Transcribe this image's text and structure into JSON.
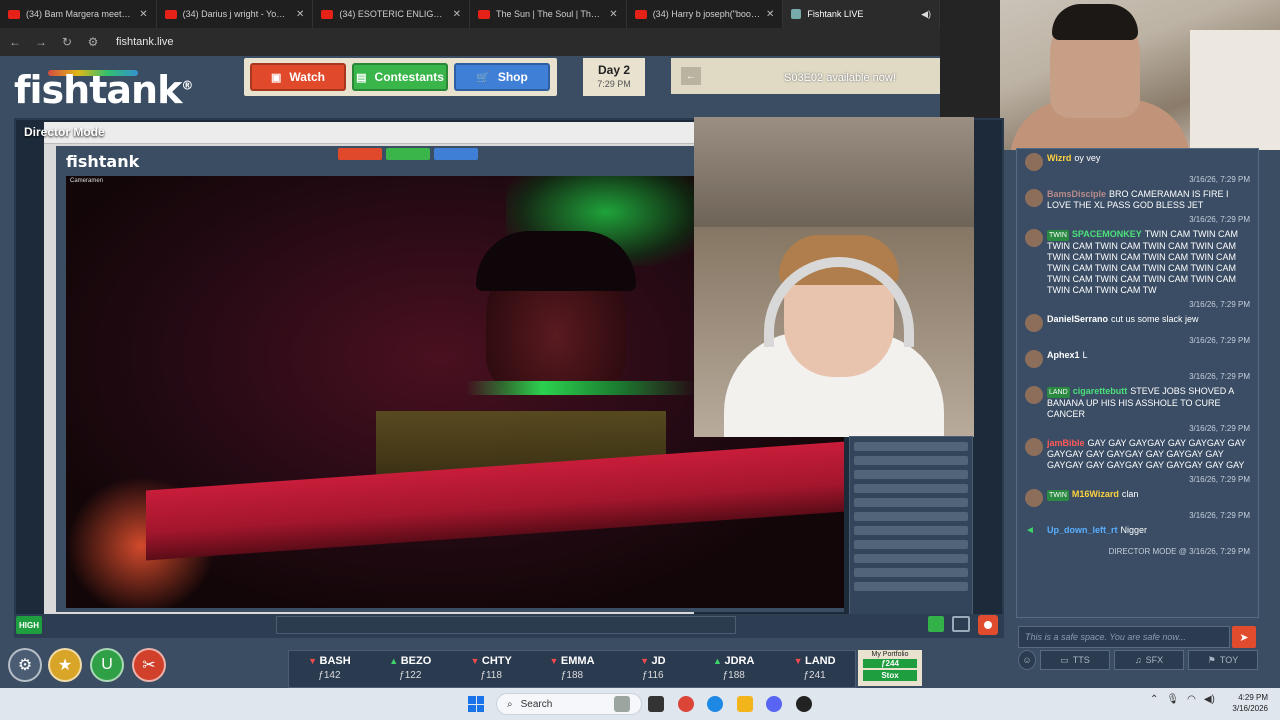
{
  "browser": {
    "tabs": [
      {
        "label": "(34) Bam Margera meets Jame",
        "icon": "youtube-icon"
      },
      {
        "label": "(34) Darius j wright - YouTube",
        "icon": "youtube-icon"
      },
      {
        "label": "(34) ESOTERIC ENLIGHTENMEN",
        "icon": "youtube-icon"
      },
      {
        "label": "The Sun | The Soul | The Four E",
        "icon": "youtube-icon"
      },
      {
        "label": "(34) Harry b joseph(\"book of w",
        "icon": "youtube-icon"
      },
      {
        "label": "Fishtank LIVE",
        "icon": "fishtank-icon"
      }
    ],
    "url": "fishtank.live"
  },
  "header": {
    "logo": "fishtank",
    "logo_mark": "®",
    "nav": {
      "watch": "Watch",
      "contestants": "Contestants",
      "shop": "Shop"
    },
    "day": "Day 2",
    "time": "7:29 PM",
    "notice": "S03E02 available now!"
  },
  "stage": {
    "mode_label": "Director Mode",
    "inner_logo": "fishtank",
    "camera_label": "Cameramen",
    "quality": "HIGH"
  },
  "ticker": [
    {
      "symbol": "BASH",
      "dir": "down",
      "price": "ƒ142"
    },
    {
      "symbol": "BEZO",
      "dir": "up",
      "price": "ƒ122"
    },
    {
      "symbol": "CHTY",
      "dir": "down",
      "price": "ƒ118"
    },
    {
      "symbol": "EMMA",
      "dir": "down",
      "price": "ƒ188"
    },
    {
      "symbol": "JD",
      "dir": "down",
      "price": "ƒ116"
    },
    {
      "symbol": "JDRA",
      "dir": "up",
      "price": "ƒ188"
    },
    {
      "symbol": "LAND",
      "dir": "down",
      "price": "ƒ241"
    }
  ],
  "portfolio": {
    "title": "My Portfolio",
    "value": "ƒ244",
    "button": "Stox"
  },
  "chat": {
    "messages": [
      {
        "user": "Wizrd",
        "text": "oy vey",
        "time": "3/16/26, 7:29 PM",
        "color": "yellow"
      },
      {
        "user": "BamsDisciple",
        "text": "BRO CAMERAMAN IS FIRE I LOVE THE XL PASS GOD BLESS JET",
        "time": "3/16/26, 7:29 PM",
        "color": "faded"
      },
      {
        "badge": "TWIN",
        "user": "SPACEMONKEY",
        "text": "TWIN CAM TWIN CAM TWIN CAM TWIN CAM TWIN CAM TWIN CAM TWIN CAM TWIN CAM TWIN CAM TWIN CAM TWIN CAM TWIN CAM TWIN CAM TWIN CAM TWIN CAM TWIN CAM TWIN CAM TWIN CAM TWIN CAM TWIN CAM TW",
        "time": "3/16/26, 7:29 PM",
        "color": "green"
      },
      {
        "user": "DanielSerrano",
        "text": "cut us some slack jew",
        "time": "3/16/26, 7:29 PM",
        "color": "yellow"
      },
      {
        "user": "Aphex1",
        "text": "L",
        "time": "3/16/26, 7:29 PM",
        "color": "yellow"
      },
      {
        "badge": "LAND",
        "user": "cigarettebutt",
        "text": "STEVE JOBS SHOVED A BANANA UP HIS HIS ASSHOLE TO CURE CANCER",
        "time": "3/16/26, 7:29 PM",
        "color": "green"
      },
      {
        "user": "jamBible",
        "text": "GAY GAY GAYGAY GAY GAYGAY GAY GAYGAY GAY GAYGAY GAY GAYGAY GAY GAYGAY GAY GAYGAY GAY GAYGAY GAY GAY",
        "time": "3/16/26, 7:29 PM",
        "color": "red"
      },
      {
        "badge": "TWIN",
        "user": "M16Wizard",
        "text": "clan",
        "time": "3/16/26, 7:29 PM",
        "color": "yellow"
      },
      {
        "user": "Up_down_left_rt",
        "text": "Nigger",
        "time": "DIRECTOR MODE @ 3/16/26, 7:29 PM",
        "color": "blue"
      }
    ],
    "input_placeholder": "This is a safe space. You are safe now...",
    "buttons": {
      "tts": "TTS",
      "sfx": "SFX",
      "toy": "TOY"
    }
  },
  "taskbar": {
    "search": "Search",
    "time": "4:29 PM",
    "date": "3/16/2026"
  },
  "colors": {
    "page_bg": "#3b4d63",
    "watch": "#e04a2b",
    "contestants": "#39b54a",
    "shop": "#3f7fd6",
    "accent_red": "#e24c2e"
  }
}
